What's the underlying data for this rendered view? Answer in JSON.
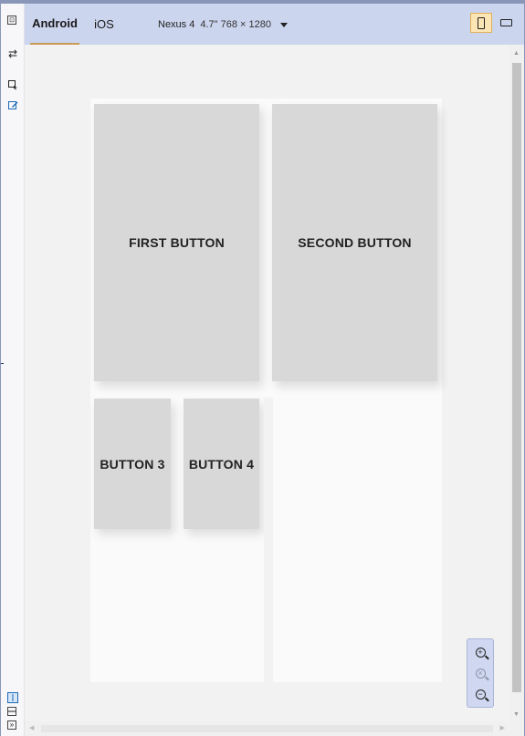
{
  "platform_tabs": [
    {
      "label": "Android",
      "active": true
    },
    {
      "label": "iOS",
      "active": false
    }
  ],
  "device": {
    "name": "Nexus 4",
    "dims": "4.7\" 768 × 1280"
  },
  "buttons": {
    "first": "FIRST BUTTON",
    "second": "SECOND BUTTON",
    "third": "BUTTON 3",
    "fourth": "BUTTON 4"
  },
  "icons": {
    "left_toolbar": [
      "properties-icon",
      "swap-icon",
      "select-element-icon",
      "edit-icon"
    ],
    "bottom_left": [
      "split-vertical-icon",
      "split-horizontal-icon",
      "expand-icon"
    ],
    "zoom": [
      "zoom-in-icon",
      "zoom-fit-icon",
      "zoom-out-icon"
    ],
    "orientation": [
      "portrait-icon",
      "landscape-icon"
    ]
  },
  "colors": {
    "toolbar_bg": "#ccd5ee",
    "active_tab_underline": "#c89a55",
    "button_bg": "#d8d8d8",
    "canvas_bg": "#f2f2f2",
    "portrait_active_bg": "#fbe5b4"
  }
}
